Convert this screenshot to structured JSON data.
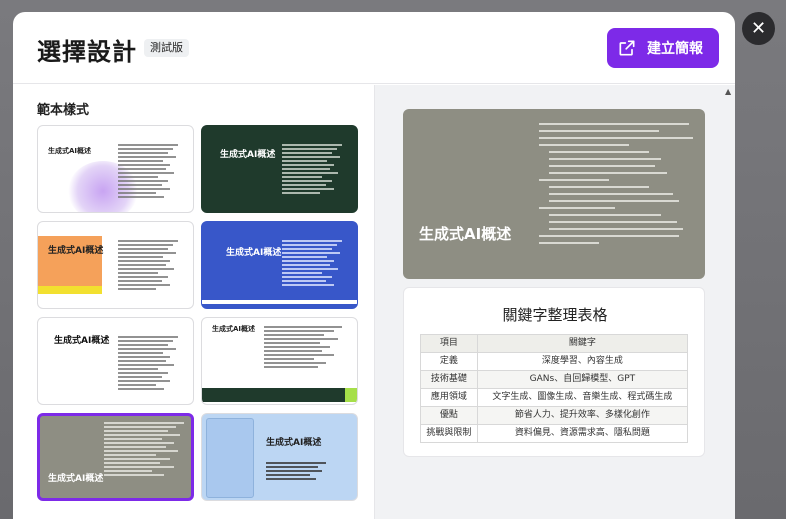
{
  "dialog": {
    "title": "選擇設計",
    "beta_badge": "測試版",
    "create_button": "建立簡報",
    "close_icon": "close-icon"
  },
  "templates": {
    "section_label": "範本樣式",
    "thumb_title": "生成式AI概述",
    "items": [
      {
        "name": "template-lavender",
        "bg": "#ffffff"
      },
      {
        "name": "template-dark-green",
        "bg": "#1f3a2c"
      },
      {
        "name": "template-orange-block",
        "bg": "#ffffff"
      },
      {
        "name": "template-blue",
        "bg": "#3857c9"
      },
      {
        "name": "template-white-plain",
        "bg": "#ffffff"
      },
      {
        "name": "template-white-green-corner",
        "bg": "#ffffff"
      },
      {
        "name": "template-gray-selected",
        "bg": "#8e8e83"
      },
      {
        "name": "template-light-blue",
        "bg": "#bcd6f3"
      }
    ]
  },
  "preview": {
    "slide_title": "生成式AI概述",
    "table_title": "關鍵字整理表格",
    "table_headers": [
      "項目",
      "關鍵字"
    ],
    "table_rows": [
      [
        "定義",
        "深度學習、內容生成"
      ],
      [
        "技術基礎",
        "GANs、自回歸模型、GPT"
      ],
      [
        "應用領域",
        "文字生成、圖像生成、音樂生成、程式碼生成"
      ],
      [
        "優點",
        "節省人力、提升效率、多樣化創作"
      ],
      [
        "挑戰與限制",
        "資料偏見、資源需求高、隱私問題"
      ]
    ]
  },
  "colors": {
    "accent": "#7d2ae8",
    "preview_bg": "#8e8e83"
  }
}
